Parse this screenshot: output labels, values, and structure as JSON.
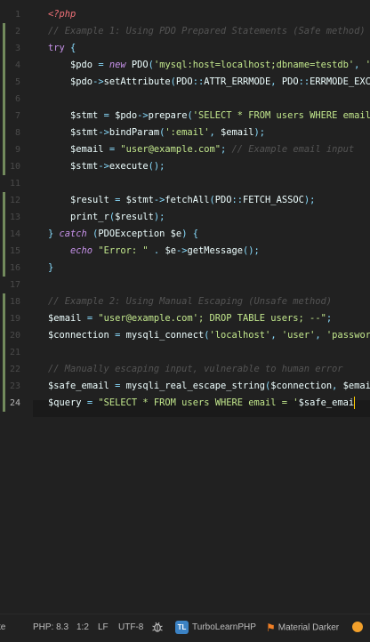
{
  "editor": {
    "active_line": 24,
    "lines": [
      {
        "n": 1,
        "tokens": [
          [
            "t-tag",
            "<?php"
          ]
        ]
      },
      {
        "n": 2,
        "tokens": [
          [
            "t-com",
            "// Example 1: Using PDO Prepared Statements (Safe method)"
          ]
        ]
      },
      {
        "n": 3,
        "tokens": [
          [
            "t-kw",
            "try"
          ],
          [
            "t-txt",
            " "
          ],
          [
            "t-pun",
            "{"
          ]
        ]
      },
      {
        "n": 4,
        "tokens": [
          [
            "t-txt",
            "    "
          ],
          [
            "t-var",
            "$pdo"
          ],
          [
            "t-txt",
            " "
          ],
          [
            "t-op",
            "="
          ],
          [
            "t-txt",
            " "
          ],
          [
            "t-kwi",
            "new"
          ],
          [
            "t-txt",
            " PDO"
          ],
          [
            "t-pun",
            "("
          ],
          [
            "t-str",
            "'mysql:host=localhost;dbname=testdb'"
          ],
          [
            "t-pun",
            ","
          ],
          [
            "t-txt",
            " "
          ],
          [
            "t-str",
            "'user'"
          ]
        ]
      },
      {
        "n": 5,
        "tokens": [
          [
            "t-txt",
            "    "
          ],
          [
            "t-var",
            "$pdo"
          ],
          [
            "t-op",
            "->"
          ],
          [
            "t-fn",
            "setAttribute"
          ],
          [
            "t-pun",
            "("
          ],
          [
            "t-txt",
            "PDO"
          ],
          [
            "t-op",
            "::"
          ],
          [
            "t-txt",
            "ATTR_ERRMODE"
          ],
          [
            "t-pun",
            ","
          ],
          [
            "t-txt",
            " PDO"
          ],
          [
            "t-op",
            "::"
          ],
          [
            "t-txt",
            "ERRMODE_EXCEPTION"
          ]
        ]
      },
      {
        "n": 6,
        "tokens": []
      },
      {
        "n": 7,
        "tokens": [
          [
            "t-txt",
            "    "
          ],
          [
            "t-var",
            "$stmt"
          ],
          [
            "t-txt",
            " "
          ],
          [
            "t-op",
            "="
          ],
          [
            "t-txt",
            " "
          ],
          [
            "t-var",
            "$pdo"
          ],
          [
            "t-op",
            "->"
          ],
          [
            "t-fn",
            "prepare"
          ],
          [
            "t-pun",
            "("
          ],
          [
            "t-str",
            "'SELECT * FROM users WHERE email = "
          ]
        ]
      },
      {
        "n": 8,
        "tokens": [
          [
            "t-txt",
            "    "
          ],
          [
            "t-var",
            "$stmt"
          ],
          [
            "t-op",
            "->"
          ],
          [
            "t-fn",
            "bindParam"
          ],
          [
            "t-pun",
            "("
          ],
          [
            "t-str",
            "':email'"
          ],
          [
            "t-pun",
            ","
          ],
          [
            "t-txt",
            " "
          ],
          [
            "t-var",
            "$email"
          ],
          [
            "t-pun",
            ");"
          ]
        ]
      },
      {
        "n": 9,
        "tokens": [
          [
            "t-txt",
            "    "
          ],
          [
            "t-var",
            "$email"
          ],
          [
            "t-txt",
            " "
          ],
          [
            "t-op",
            "="
          ],
          [
            "t-txt",
            " "
          ],
          [
            "t-str",
            "\"user@example.com\""
          ],
          [
            "t-pun",
            ";"
          ],
          [
            "t-txt",
            " "
          ],
          [
            "t-com",
            "// Example email input"
          ]
        ]
      },
      {
        "n": 10,
        "tokens": [
          [
            "t-txt",
            "    "
          ],
          [
            "t-var",
            "$stmt"
          ],
          [
            "t-op",
            "->"
          ],
          [
            "t-fn",
            "execute"
          ],
          [
            "t-pun",
            "();"
          ]
        ]
      },
      {
        "n": 11,
        "tokens": []
      },
      {
        "n": 12,
        "tokens": [
          [
            "t-txt",
            "    "
          ],
          [
            "t-var",
            "$result"
          ],
          [
            "t-txt",
            " "
          ],
          [
            "t-op",
            "="
          ],
          [
            "t-txt",
            " "
          ],
          [
            "t-var",
            "$stmt"
          ],
          [
            "t-op",
            "->"
          ],
          [
            "t-fn",
            "fetchAll"
          ],
          [
            "t-pun",
            "("
          ],
          [
            "t-txt",
            "PDO"
          ],
          [
            "t-op",
            "::"
          ],
          [
            "t-txt",
            "FETCH_ASSOC"
          ],
          [
            "t-pun",
            ");"
          ]
        ]
      },
      {
        "n": 13,
        "tokens": [
          [
            "t-txt",
            "    "
          ],
          [
            "t-fn",
            "print_r"
          ],
          [
            "t-pun",
            "("
          ],
          [
            "t-var",
            "$result"
          ],
          [
            "t-pun",
            ");"
          ]
        ]
      },
      {
        "n": 14,
        "tokens": [
          [
            "t-pun",
            "}"
          ],
          [
            "t-txt",
            " "
          ],
          [
            "t-kwi",
            "catch"
          ],
          [
            "t-txt",
            " "
          ],
          [
            "t-pun",
            "("
          ],
          [
            "t-txt",
            "PDOException "
          ],
          [
            "t-var",
            "$e"
          ],
          [
            "t-pun",
            ")"
          ],
          [
            "t-txt",
            " "
          ],
          [
            "t-pun",
            "{"
          ]
        ]
      },
      {
        "n": 15,
        "tokens": [
          [
            "t-txt",
            "    "
          ],
          [
            "t-kwi",
            "echo"
          ],
          [
            "t-txt",
            " "
          ],
          [
            "t-str",
            "\"Error: \""
          ],
          [
            "t-txt",
            " "
          ],
          [
            "t-op",
            "."
          ],
          [
            "t-txt",
            " "
          ],
          [
            "t-var",
            "$e"
          ],
          [
            "t-op",
            "->"
          ],
          [
            "t-fn",
            "getMessage"
          ],
          [
            "t-pun",
            "();"
          ]
        ]
      },
      {
        "n": 16,
        "tokens": [
          [
            "t-pun",
            "}"
          ]
        ]
      },
      {
        "n": 17,
        "tokens": []
      },
      {
        "n": 18,
        "tokens": [
          [
            "t-com",
            "// Example 2: Using Manual Escaping (Unsafe method)"
          ]
        ]
      },
      {
        "n": 19,
        "tokens": [
          [
            "t-var",
            "$email"
          ],
          [
            "t-txt",
            " "
          ],
          [
            "t-op",
            "="
          ],
          [
            "t-txt",
            " "
          ],
          [
            "t-str",
            "\"user@example.com'; DROP TABLE users; --\""
          ],
          [
            "t-pun",
            ";"
          ]
        ]
      },
      {
        "n": 20,
        "tokens": [
          [
            "t-var",
            "$connection"
          ],
          [
            "t-txt",
            " "
          ],
          [
            "t-op",
            "="
          ],
          [
            "t-txt",
            " "
          ],
          [
            "t-fn",
            "mysqli_connect"
          ],
          [
            "t-pun",
            "("
          ],
          [
            "t-str",
            "'localhost'"
          ],
          [
            "t-pun",
            ","
          ],
          [
            "t-txt",
            " "
          ],
          [
            "t-str",
            "'user'"
          ],
          [
            "t-pun",
            ","
          ],
          [
            "t-txt",
            " "
          ],
          [
            "t-str",
            "'password'"
          ],
          [
            "t-pun",
            ","
          ]
        ]
      },
      {
        "n": 21,
        "tokens": []
      },
      {
        "n": 22,
        "tokens": [
          [
            "t-com",
            "// Manually escaping input, vulnerable to human error"
          ]
        ]
      },
      {
        "n": 23,
        "tokens": [
          [
            "t-var",
            "$safe_email"
          ],
          [
            "t-txt",
            " "
          ],
          [
            "t-op",
            "="
          ],
          [
            "t-txt",
            " "
          ],
          [
            "t-fn",
            "mysqli_real_escape_string"
          ],
          [
            "t-pun",
            "("
          ],
          [
            "t-var",
            "$connection"
          ],
          [
            "t-pun",
            ","
          ],
          [
            "t-txt",
            " "
          ],
          [
            "t-var",
            "$email"
          ],
          [
            "t-pun",
            ");"
          ]
        ]
      },
      {
        "n": 24,
        "tokens": [
          [
            "t-var",
            "$query"
          ],
          [
            "t-txt",
            " "
          ],
          [
            "t-op",
            "="
          ],
          [
            "t-txt",
            " "
          ],
          [
            "t-str",
            "\"SELECT * FROM users WHERE email = '"
          ],
          [
            "t-var",
            "$safe_emai"
          ]
        ]
      }
    ]
  },
  "statusbar": {
    "left_fragment": "te",
    "php_version": "PHP: 8.3",
    "cursor_pos": "1:2",
    "line_ending": "LF",
    "encoding": "UTF-8",
    "plugin_badge": "TL",
    "plugin_name": "TurboLearnPHP",
    "theme_name": "Material Darker"
  },
  "colors": {
    "background": "#212121",
    "vcs_marker": "#728a5c",
    "scrollbar_thumb": "#b86a2c",
    "caret": "#ffcc00",
    "notification_dot": "#f2a02b"
  },
  "icons": {
    "debug": "bug-icon",
    "theme": "material-theme-icon",
    "notification": "notification-dot-icon"
  }
}
